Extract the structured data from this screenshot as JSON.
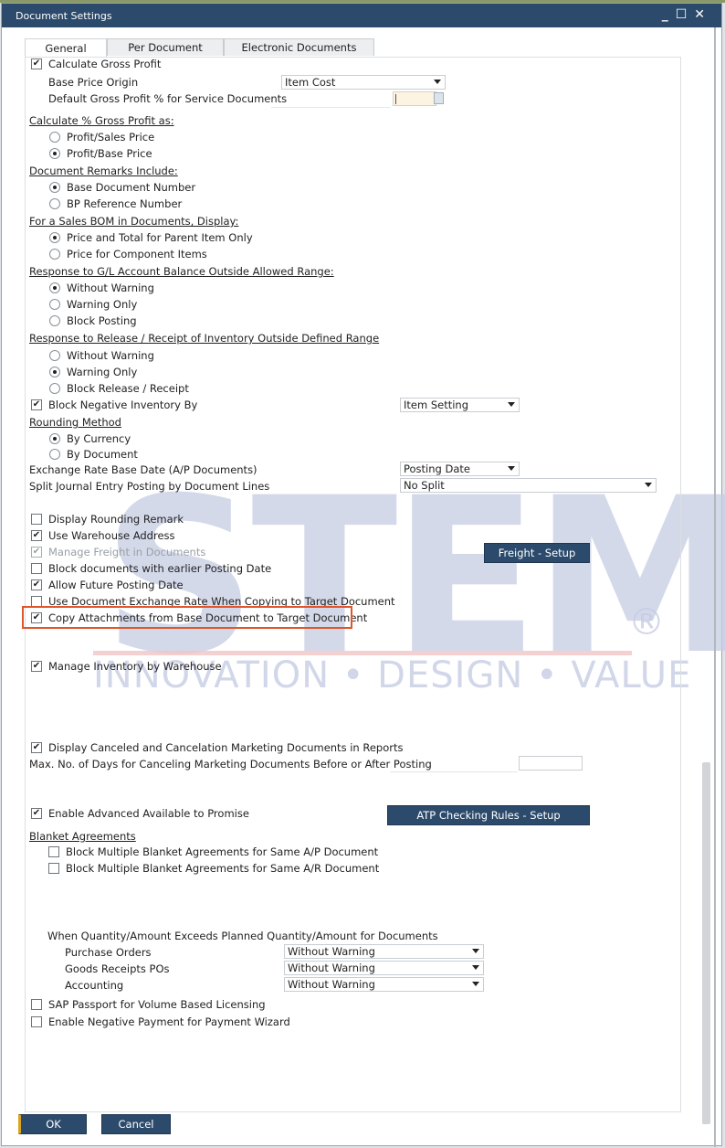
{
  "window": {
    "title": "Document Settings",
    "controls": {
      "minimize": "_",
      "maximize": "☐",
      "close": "✕"
    }
  },
  "tabs": [
    {
      "label": "General",
      "active": true
    },
    {
      "label": "Per Document",
      "active": false
    },
    {
      "label": "Electronic Documents",
      "active": false
    }
  ],
  "gross_profit": {
    "calculate_label": "Calculate Gross Profit",
    "calculate_checked": true,
    "base_price_origin_label": "Base Price Origin",
    "base_price_origin_value": "Item Cost",
    "default_gp_label": "Default Gross Profit % for Service Documents",
    "default_gp_value": ""
  },
  "calc_percent": {
    "header": "Calculate % Gross Profit as:",
    "options": [
      {
        "label": "Profit/Sales Price",
        "selected": false
      },
      {
        "label": "Profit/Base Price",
        "selected": true
      }
    ]
  },
  "remarks": {
    "header": "Document Remarks Include:",
    "options": [
      {
        "label": "Base Document Number",
        "selected": true
      },
      {
        "label": "BP Reference Number",
        "selected": false
      }
    ]
  },
  "sales_bom": {
    "header": "For a Sales BOM in Documents, Display:",
    "options": [
      {
        "label": "Price and Total for Parent Item Only",
        "selected": true
      },
      {
        "label": "Price for Component Items",
        "selected": false
      }
    ]
  },
  "gl_response": {
    "header": "Response to G/L Account Balance Outside Allowed Range:",
    "options": [
      {
        "label": "Without Warning",
        "selected": true
      },
      {
        "label": "Warning Only",
        "selected": false
      },
      {
        "label": "Block Posting",
        "selected": false
      }
    ]
  },
  "inv_response": {
    "header": "Response to Release / Receipt of Inventory Outside Defined Range",
    "options": [
      {
        "label": "Without Warning",
        "selected": false
      },
      {
        "label": "Warning Only",
        "selected": true
      },
      {
        "label": "Block Release / Receipt",
        "selected": false
      }
    ]
  },
  "block_negative": {
    "label": "Block Negative Inventory By",
    "checked": true,
    "value": "Item Setting"
  },
  "rounding": {
    "header": "Rounding Method",
    "options": [
      {
        "label": "By Currency",
        "selected": true
      },
      {
        "label": "By Document",
        "selected": false
      }
    ]
  },
  "exchange_rate": {
    "label": "Exchange Rate Base Date (A/P Documents)",
    "value": "Posting Date"
  },
  "split_journal": {
    "label": "Split Journal Entry Posting by Document Lines",
    "value": "No Split"
  },
  "checkboxes_a": [
    {
      "label": "Display Rounding Remark",
      "checked": false,
      "disabled": false
    },
    {
      "label": "Use Warehouse Address",
      "checked": true,
      "disabled": false
    },
    {
      "label": "Manage Freight in Documents",
      "checked": true,
      "disabled": true
    },
    {
      "label": "Block documents with earlier Posting Date",
      "checked": false,
      "disabled": false
    },
    {
      "label": "Allow Future Posting Date",
      "checked": true,
      "disabled": false
    },
    {
      "label": "Use Document Exchange Rate When Copying to Target Document",
      "checked": false,
      "disabled": false
    },
    {
      "label": "Copy Attachments from Base Document to Target Document",
      "checked": true,
      "disabled": false
    }
  ],
  "freight_button": "Freight - Setup",
  "manage_inventory": {
    "label": "Manage Inventory by Warehouse",
    "checked": true
  },
  "display_canceled": {
    "label": "Display Canceled and Cancelation Marketing Documents in Reports",
    "checked": true
  },
  "max_days": {
    "label": "Max. No. of Days for Canceling Marketing Documents Before or After Posting",
    "value": ""
  },
  "atp": {
    "label": "Enable Advanced Available to Promise",
    "checked": true,
    "button": "ATP Checking Rules - Setup"
  },
  "blanket": {
    "header": "Blanket Agreements",
    "options": [
      {
        "label": "Block Multiple Blanket Agreements for Same A/P Document",
        "checked": false
      },
      {
        "label": "Block Multiple Blanket Agreements for Same A/R Document",
        "checked": false
      }
    ]
  },
  "exceeds": {
    "header": "When Quantity/Amount Exceeds Planned Quantity/Amount for Documents",
    "rows": [
      {
        "label": "Purchase Orders",
        "value": "Without Warning"
      },
      {
        "label": "Goods Receipts POs",
        "value": "Without Warning"
      },
      {
        "label": "Accounting",
        "value": "Without Warning"
      }
    ]
  },
  "sap_passport": {
    "label": "SAP Passport for Volume Based Licensing",
    "checked": false
  },
  "negative_payment": {
    "label": "Enable Negative Payment for Payment Wizard",
    "checked": false
  },
  "footer": {
    "ok": "OK",
    "cancel": "Cancel"
  },
  "watermark": {
    "brand": "STEM",
    "registered": "®",
    "tagline": "INNOVATION • DESIGN • VALUE"
  },
  "colors": {
    "titlebar": "#2c4a6b",
    "button": "#2c4a6b",
    "highlight": "#e0562c",
    "number_field": "#fdf3e1"
  }
}
